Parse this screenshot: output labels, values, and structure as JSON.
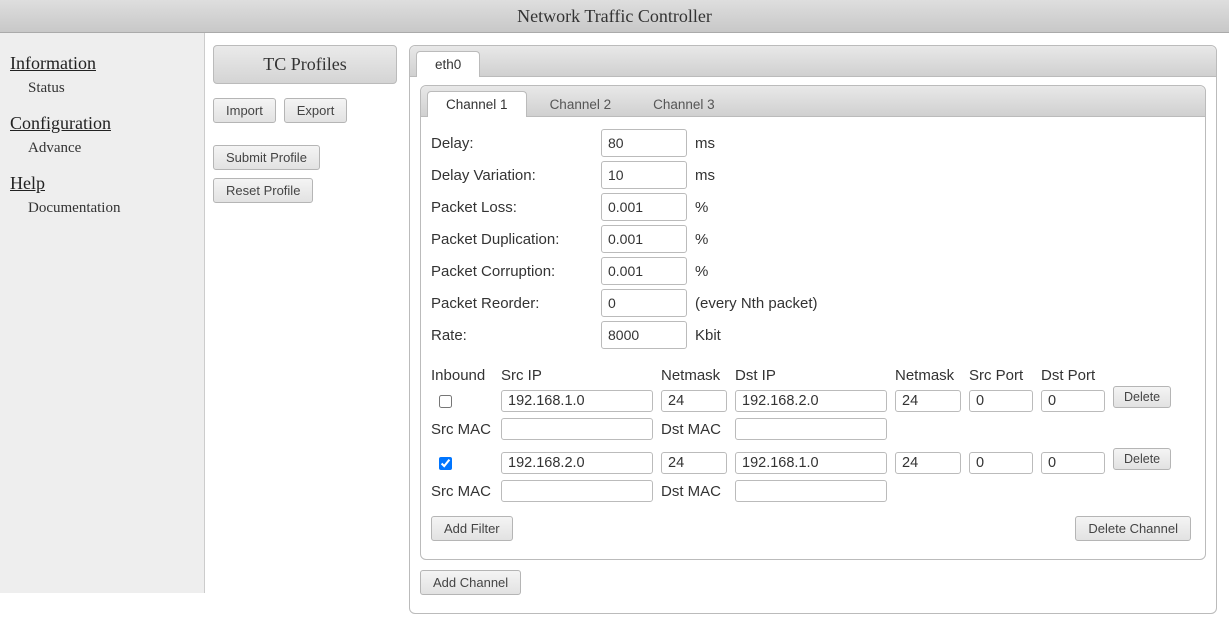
{
  "title": "Network Traffic Controller",
  "sidebar": {
    "sections": [
      {
        "title": "Information",
        "items": [
          "Status"
        ]
      },
      {
        "title": "Configuration",
        "items": [
          "Advance"
        ]
      },
      {
        "title": "Help",
        "items": [
          "Documentation"
        ]
      }
    ]
  },
  "midcol": {
    "header": "TC Profiles",
    "import_label": "Import",
    "export_label": "Export",
    "submit_label": "Submit Profile",
    "reset_label": "Reset Profile"
  },
  "main": {
    "interface_tabs": [
      "eth0"
    ],
    "active_interface": 0,
    "channel_tabs": [
      "Channel 1",
      "Channel 2",
      "Channel 3"
    ],
    "active_channel": 0,
    "params": [
      {
        "label": "Delay:",
        "value": "80",
        "unit": "ms"
      },
      {
        "label": "Delay Variation:",
        "value": "10",
        "unit": "ms"
      },
      {
        "label": "Packet Loss:",
        "value": "0.001",
        "unit": "%"
      },
      {
        "label": "Packet Duplication:",
        "value": "0.001",
        "unit": "%"
      },
      {
        "label": "Packet Corruption:",
        "value": "0.001",
        "unit": "%"
      },
      {
        "label": "Packet Reorder:",
        "value": "0",
        "unit": "(every Nth packet)"
      },
      {
        "label": "Rate:",
        "value": "8000",
        "unit": "Kbit"
      }
    ],
    "filter_header": {
      "inbound": "Inbound",
      "src_ip": "Src IP",
      "netmask": "Netmask",
      "dst_ip": "Dst IP",
      "netmask2": "Netmask",
      "src_port": "Src Port",
      "dst_port": "Dst Port",
      "src_mac": "Src MAC",
      "dst_mac": "Dst MAC"
    },
    "filters": [
      {
        "inbound": false,
        "src_ip": "192.168.1.0",
        "netmask": "24",
        "dst_ip": "192.168.2.0",
        "netmask2": "24",
        "src_port": "0",
        "dst_port": "0",
        "src_mac": "",
        "dst_mac": ""
      },
      {
        "inbound": true,
        "src_ip": "192.168.2.0",
        "netmask": "24",
        "dst_ip": "192.168.1.0",
        "netmask2": "24",
        "src_port": "0",
        "dst_port": "0",
        "src_mac": "",
        "dst_mac": ""
      }
    ],
    "delete_label": "Delete",
    "add_filter_label": "Add Filter",
    "delete_channel_label": "Delete Channel",
    "add_channel_label": "Add Channel"
  }
}
